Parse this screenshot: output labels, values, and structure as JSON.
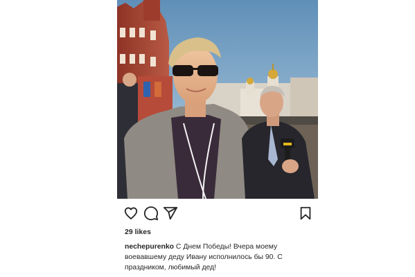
{
  "post": {
    "image": {
      "description_icon": "photo-icon"
    },
    "actions": {
      "like_icon": "heart-icon",
      "comment_icon": "comment-icon",
      "share_icon": "paper-plane-icon",
      "save_icon": "bookmark-icon"
    },
    "likes": "29 likes",
    "caption": {
      "username": "nechepurenko",
      "text": "С Днем Победы! Вчера моему воевавшему деду Ивану исполнилось бы 90. С праздником, любимый дед!"
    }
  },
  "colors": {
    "text": "#262626",
    "background": "#ffffff",
    "sky": "#7fa9c8",
    "brick": "#a5493a"
  }
}
